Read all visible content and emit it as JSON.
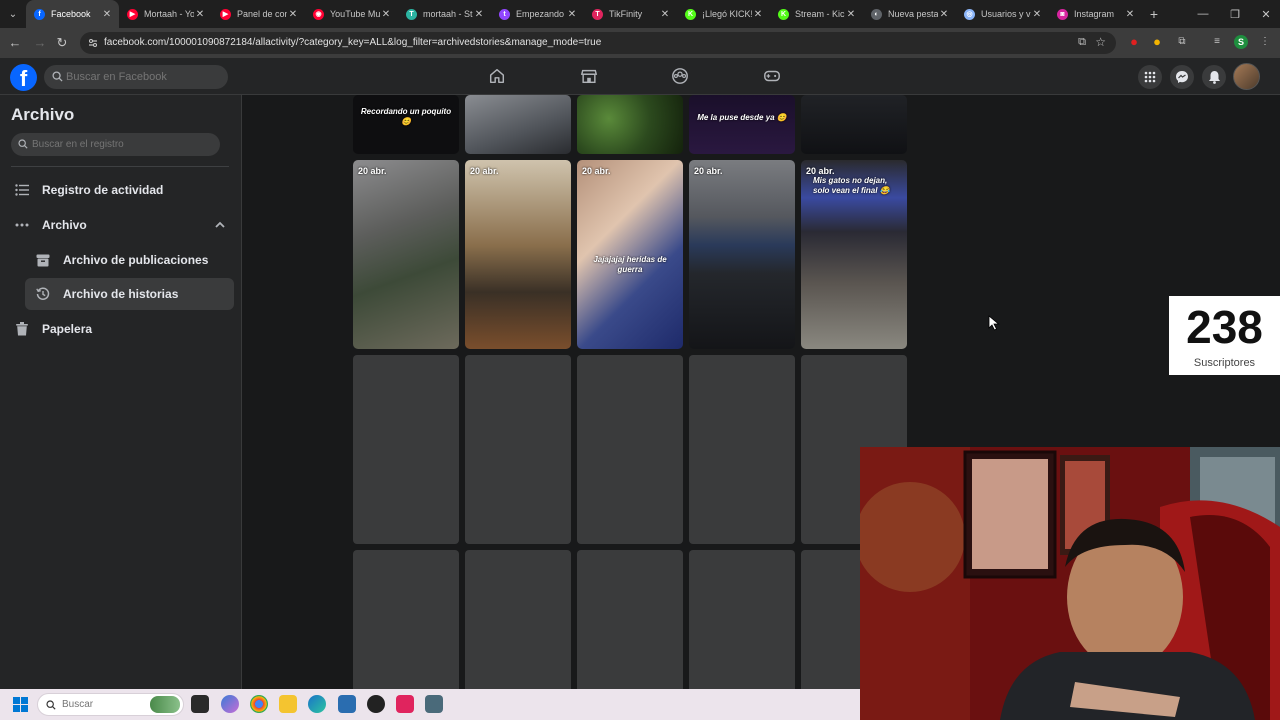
{
  "browser": {
    "tabs": [
      {
        "label": "Facebook",
        "favicon_color": "#0866ff",
        "favicon_glyph": "f",
        "active": true
      },
      {
        "label": "Mortaah - Yo",
        "favicon_color": "#ff0033",
        "favicon_glyph": "▶"
      },
      {
        "label": "Panel de con",
        "favicon_color": "#ff0033",
        "favicon_glyph": "▶"
      },
      {
        "label": "YouTube Mu",
        "favicon_color": "#ff0033",
        "favicon_glyph": "◉"
      },
      {
        "label": "mortaah - St",
        "favicon_color": "#2bb3a1",
        "favicon_glyph": "T"
      },
      {
        "label": "Empezando",
        "favicon_color": "#9146ff",
        "favicon_glyph": "t"
      },
      {
        "label": "TikFinity",
        "favicon_color": "#e0245e",
        "favicon_glyph": "T"
      },
      {
        "label": "¡Llegó KICK!",
        "favicon_color": "#53fc18",
        "favicon_glyph": "K"
      },
      {
        "label": "Stream - Kic",
        "favicon_color": "#53fc18",
        "favicon_glyph": "K"
      },
      {
        "label": "Nueva pesta",
        "favicon_color": "#5f6368",
        "favicon_glyph": "◐"
      },
      {
        "label": "Usuarios y v",
        "favicon_color": "#8ab4f8",
        "favicon_glyph": "◎"
      },
      {
        "label": "Instagram",
        "favicon_color": "#d6249f",
        "favicon_glyph": "◙"
      }
    ],
    "close_glyph": "✕",
    "new_tab_glyph": "+",
    "url": "facebook.com/100001090872184/allactivity/?category_key=ALL&log_filter=archivedstories&manage_mode=true"
  },
  "fb_header": {
    "search_placeholder": "Buscar en Facebook",
    "nav_icons": [
      "home-icon",
      "marketplace-icon",
      "groups-icon",
      "gaming-icon"
    ],
    "right_icons": [
      "menu-grid-icon",
      "messenger-icon",
      "notifications-icon",
      "profile-avatar"
    ]
  },
  "sidebar": {
    "title": "Archivo",
    "search_placeholder": "Buscar en el registro",
    "items": [
      {
        "label": "Registro de actividad",
        "icon": "list-icon"
      },
      {
        "label": "Archivo",
        "icon": "more-dots-icon",
        "expanded": true
      },
      {
        "label": "Archivo de publicaciones",
        "icon": "archive-box-icon"
      },
      {
        "label": "Archivo de historias",
        "icon": "history-clock-icon",
        "selected": true
      },
      {
        "label": "Papelera",
        "icon": "trash-icon"
      }
    ]
  },
  "stories": {
    "top_row": [
      {
        "caption": "Recordando un poquito 😊"
      },
      {
        "caption": ""
      },
      {
        "caption": ""
      },
      {
        "caption": "Me la puse desde ya 😊"
      },
      {
        "caption": ""
      }
    ],
    "dated_row": [
      {
        "date": "20 abr.",
        "caption": ""
      },
      {
        "date": "20 abr.",
        "caption": ""
      },
      {
        "date": "20 abr.",
        "caption": "Jajajajaj heridas de guerra"
      },
      {
        "date": "20 abr.",
        "caption": ""
      },
      {
        "date": "20 abr.",
        "caption": "Mis gatos no dejan, solo vean el final 😂"
      }
    ]
  },
  "overlay": {
    "subscriber_count": "238",
    "subscriber_label": "Suscriptores"
  },
  "taskbar": {
    "search_placeholder": "Buscar"
  }
}
